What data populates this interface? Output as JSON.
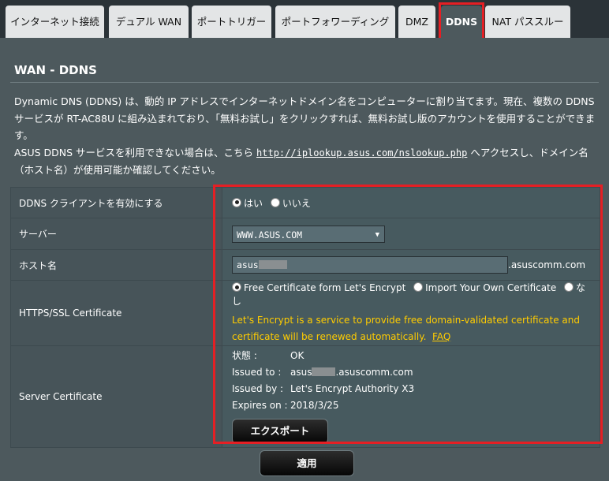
{
  "tabs": [
    {
      "label": "インターネット接続",
      "active": false
    },
    {
      "label": "デュアル WAN",
      "active": false
    },
    {
      "label": "ポートトリガー",
      "active": false
    },
    {
      "label": "ポートフォワーディング",
      "active": false
    },
    {
      "label": "DMZ",
      "active": false
    },
    {
      "label": "DDNS",
      "active": true
    },
    {
      "label": "NAT パススルー",
      "active": false
    }
  ],
  "page": {
    "title": "WAN - DDNS",
    "desc1": "Dynamic DNS (DDNS) は、動的 IP アドレスでインターネットドメイン名をコンピューターに割り当てます。現在、複数の DDNS サービスが RT-AC88U に組み込まれており、「無料お試し」をクリックすれば、無料お試し版のアカウントを使用することができます。",
    "desc2_pre": "ASUS DDNS サービスを利用できない場合は、こちら ",
    "desc2_link": "http://iplookup.asus.com/nslookup.php",
    "desc2_post": " へアクセスし、ドメイン名（ホスト名）が使用可能か確認してください。"
  },
  "form": {
    "ddns_enable": {
      "label": "DDNS クライアントを有効にする",
      "yes": "はい",
      "no": "いいえ",
      "value": "yes"
    },
    "server": {
      "label": "サーバー",
      "value": "WWW.ASUS.COM"
    },
    "hostname": {
      "label": "ホスト名",
      "value": "asus",
      "suffix": ".asuscomm.com"
    },
    "https": {
      "label": "HTTPS/SSL Certificate",
      "opt_letsencrypt": "Free Certificate form Let's Encrypt",
      "opt_import": "Import Your Own Certificate",
      "opt_none": "なし",
      "selected": "letsencrypt",
      "notice": "Let's Encrypt is a service to provide free domain-validated certificate and certificate will be renewed automatically.",
      "faq": "FAQ"
    },
    "server_cert": {
      "label": "Server Certificate",
      "status_key": "状態 :",
      "status_val": "OK",
      "issued_to_key": "Issued to :",
      "issued_to_pre": "asus",
      "issued_to_post": ".asuscomm.com",
      "issued_by_key": "Issued by :",
      "issued_by_val": "Let's Encrypt Authority X3",
      "expires_key": "Expires on :",
      "expires_val": "2018/3/25",
      "export": "エクスポート"
    }
  },
  "apply": "適用",
  "colors": {
    "highlight": "#e51f24",
    "notice": "#ffcc00",
    "panel": "#4d595d"
  }
}
